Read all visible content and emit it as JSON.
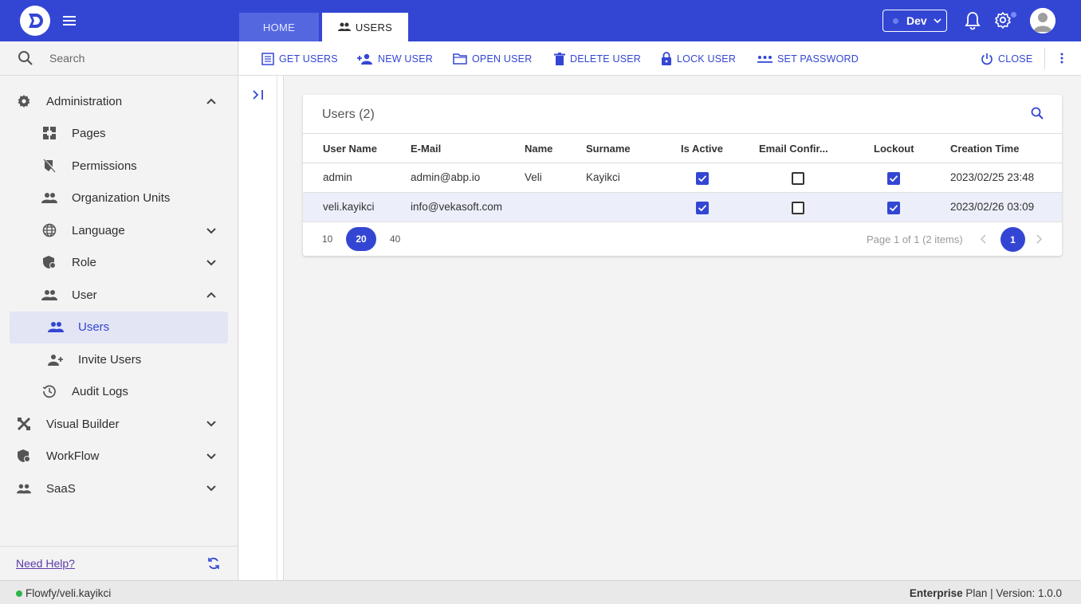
{
  "header": {
    "tabs": [
      {
        "label": "HOME"
      },
      {
        "label": "USERS"
      }
    ],
    "environment": "Dev"
  },
  "sidebar": {
    "search_placeholder": "Search",
    "items": [
      {
        "label": "Administration",
        "icon": "gear-icon"
      },
      {
        "label": "Pages",
        "icon": "pages-icon"
      },
      {
        "label": "Permissions",
        "icon": "permissions-icon"
      },
      {
        "label": "Organization Units",
        "icon": "people-icon"
      },
      {
        "label": "Language",
        "icon": "globe-icon"
      },
      {
        "label": "Role",
        "icon": "shield-icon"
      },
      {
        "label": "User",
        "icon": "people-icon"
      },
      {
        "label": "Users",
        "icon": "people-icon"
      },
      {
        "label": "Invite Users",
        "icon": "add-person-icon"
      },
      {
        "label": "Audit Logs",
        "icon": "history-icon"
      },
      {
        "label": "Visual Builder",
        "icon": "tools-icon"
      },
      {
        "label": "WorkFlow",
        "icon": "workflow-icon"
      },
      {
        "label": "SaaS",
        "icon": "people-icon"
      }
    ],
    "help_link": "Need Help?"
  },
  "toolbar": {
    "get_users": "GET USERS",
    "new_user": "NEW USER",
    "open_user": "OPEN USER",
    "delete_user": "DELETE USER",
    "lock_user": "LOCK USER",
    "set_password": "SET PASSWORD",
    "close": "CLOSE"
  },
  "table": {
    "title": "Users (2)",
    "columns": [
      "User Name",
      "E-Mail",
      "Name",
      "Surname",
      "Is Active",
      "Email Confir...",
      "Lockout",
      "Creation Time"
    ],
    "rows": [
      {
        "username": "admin",
        "email": "admin@abp.io",
        "name": "Veli",
        "surname": "Kayikci",
        "is_active": true,
        "email_confirmed": false,
        "lockout": true,
        "created": "2023/02/25 23:48"
      },
      {
        "username": "veli.kayikci",
        "email": "info@vekasoft.com",
        "name": "",
        "surname": "",
        "is_active": true,
        "email_confirmed": false,
        "lockout": true,
        "created": "2023/02/26 03:09"
      }
    ],
    "page_sizes": [
      "10",
      "20",
      "40"
    ],
    "selected_page_size": "20",
    "page_info": "Page 1 of 1 (2 items)",
    "current_page": "1"
  },
  "statusbar": {
    "user_path": "Flowfy/veli.kayikci",
    "plan_bold": "Enterprise",
    "plan_rest": " Plan | Version: 1.0.0"
  },
  "colors": {
    "primary": "#3346d3",
    "status_green": "#2fb54a"
  }
}
